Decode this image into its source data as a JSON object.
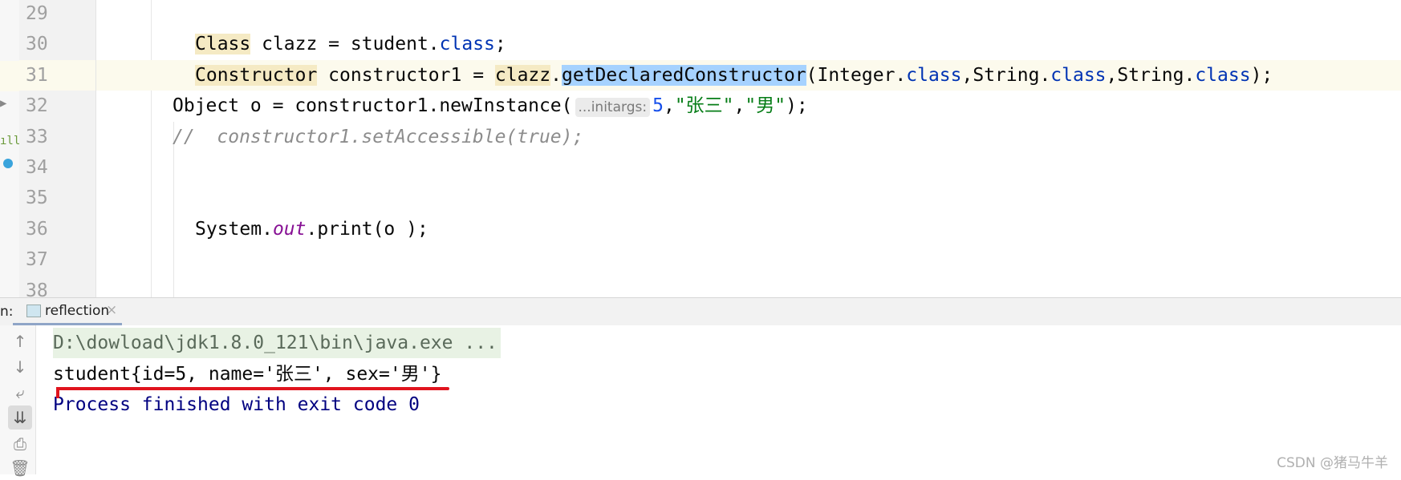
{
  "editor": {
    "lines": [
      {
        "n": "29",
        "tokens": []
      },
      {
        "n": "30",
        "indent": "  ",
        "tokens": [
          {
            "t": "Class",
            "c": "hl"
          },
          {
            "t": " clazz = student."
          },
          {
            "t": "class",
            "c": "kw"
          },
          {
            "t": ";"
          }
        ]
      },
      {
        "n": "31",
        "current": true,
        "indent": "  ",
        "tokens": [
          {
            "t": "Constructor",
            "c": "hl"
          },
          {
            "t": " constructor1 = "
          },
          {
            "t": "clazz",
            "c": "hl"
          },
          {
            "t": "."
          },
          {
            "t": "getDeclaredConstructor",
            "c": "sel"
          },
          {
            "t": "(Integer."
          },
          {
            "t": "class",
            "c": "kw"
          },
          {
            "t": ",String."
          },
          {
            "t": "class",
            "c": "kw"
          },
          {
            "t": ",String."
          },
          {
            "t": "class",
            "c": "kw"
          },
          {
            "t": ");"
          }
        ]
      },
      {
        "n": "32",
        "indent": "",
        "tokens": [
          {
            "t": "Object o = constructor1.newInstance("
          },
          {
            "t": "...initargs:",
            "c": "hint"
          },
          {
            "t": "5",
            "c": "num"
          },
          {
            "t": ","
          },
          {
            "t": "\"张三\"",
            "c": "str"
          },
          {
            "t": ","
          },
          {
            "t": "\"男\"",
            "c": "str"
          },
          {
            "t": ");"
          }
        ]
      },
      {
        "n": "33",
        "indent": "",
        "tokens": [
          {
            "t": "//  constructor1.setAccessible(true);",
            "c": "cmt"
          }
        ]
      },
      {
        "n": "34",
        "tokens": []
      },
      {
        "n": "35",
        "tokens": []
      },
      {
        "n": "36",
        "indent": "  ",
        "tokens": [
          {
            "t": "System."
          },
          {
            "t": "out",
            "c": "fld"
          },
          {
            "t": ".print(o );"
          }
        ]
      },
      {
        "n": "37",
        "tokens": []
      },
      {
        "n": "38",
        "tokens": []
      }
    ]
  },
  "run_panel": {
    "label": "n:",
    "tab": {
      "label": "reflection",
      "close": "×"
    },
    "toolbar": [
      {
        "name": "up-arrow-icon",
        "glyph": "↑"
      },
      {
        "name": "down-arrow-icon",
        "glyph": "↓"
      },
      {
        "name": "soft-wrap-icon",
        "glyph": "⤶"
      },
      {
        "name": "scroll-to-end-icon",
        "glyph": "⇊",
        "active": true
      },
      {
        "name": "print-icon",
        "glyph": "⎙"
      },
      {
        "name": "trash-icon",
        "glyph": "🗑"
      }
    ],
    "output": [
      {
        "text": "D:\\dowload\\jdk1.8.0_121\\bin\\java.exe ...",
        "color": "#5a6a5a",
        "bg": "#e8f2e4"
      },
      {
        "text": "student{id=5, name='张三', sex='男'}",
        "color": "#080808"
      },
      {
        "text": "Process finished with exit code 0",
        "color": "#000080"
      }
    ],
    "annotation_color": "#e0141e"
  },
  "watermark": "CSDN @猪马牛羊"
}
